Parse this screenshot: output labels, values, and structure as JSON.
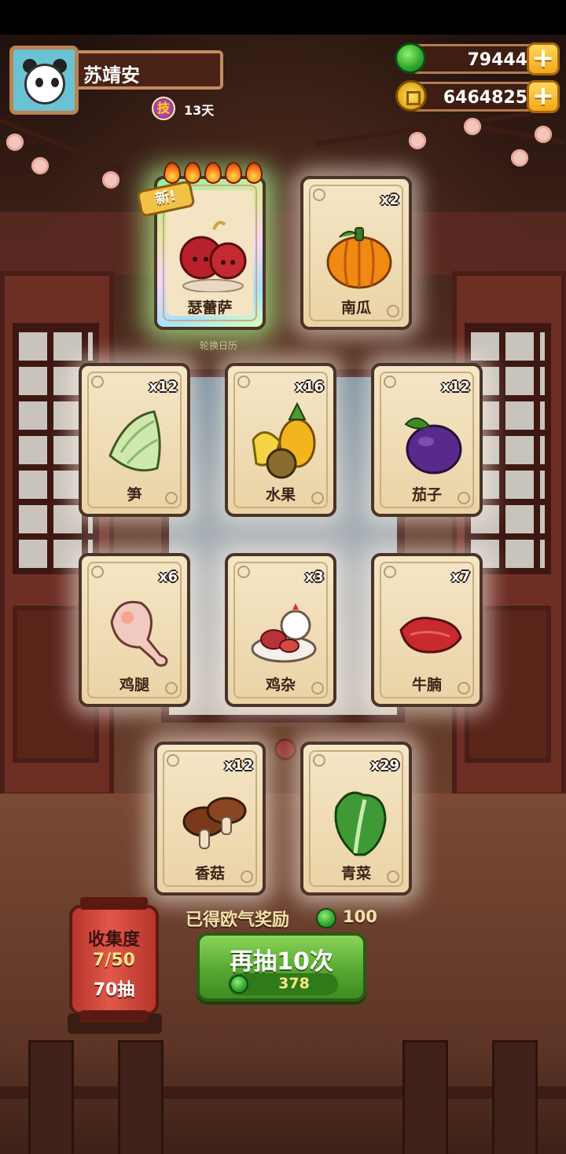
{
  "profile": {
    "name": "苏靖安",
    "skill_badge": "技",
    "skill_days": "13天"
  },
  "currency": {
    "jade": "79444",
    "coins": "6464825",
    "add_label": "+"
  },
  "banner_caption": "轮换日历",
  "cards": [
    {
      "name": "瑟蕾萨",
      "count": "",
      "tag": "新!",
      "rarity": "special",
      "stars": 5,
      "icon": "cherry-tomato-icon"
    },
    {
      "name": "南瓜",
      "count": "x2",
      "icon": "pumpkin-icon"
    },
    {
      "name": "笋",
      "count": "x12",
      "icon": "bamboo-shoot-icon"
    },
    {
      "name": "水果",
      "count": "x16",
      "icon": "fruit-icon"
    },
    {
      "name": "茄子",
      "count": "x12",
      "icon": "eggplant-icon"
    },
    {
      "name": "鸡腿",
      "count": "x6",
      "icon": "chicken-leg-icon"
    },
    {
      "name": "鸡杂",
      "count": "x3",
      "icon": "chicken-giblets-icon"
    },
    {
      "name": "牛腩",
      "count": "x7",
      "icon": "beef-brisket-icon"
    },
    {
      "name": "香菇",
      "count": "x12",
      "icon": "shiitake-icon"
    },
    {
      "name": "青菜",
      "count": "x29",
      "icon": "bok-choy-icon"
    }
  ],
  "reward": {
    "label": "已得欧气奖励",
    "value": "100"
  },
  "draw_button": {
    "label": "再抽10次",
    "cost": "378"
  },
  "collection": {
    "title": "收集度",
    "progress": "7/50",
    "draws": "70抽"
  },
  "colors": {
    "draw_green": "#55a831",
    "card_parchment": "#f5e6c7",
    "lantern_red": "#d2473b",
    "currency_frame": "#b27c50"
  }
}
